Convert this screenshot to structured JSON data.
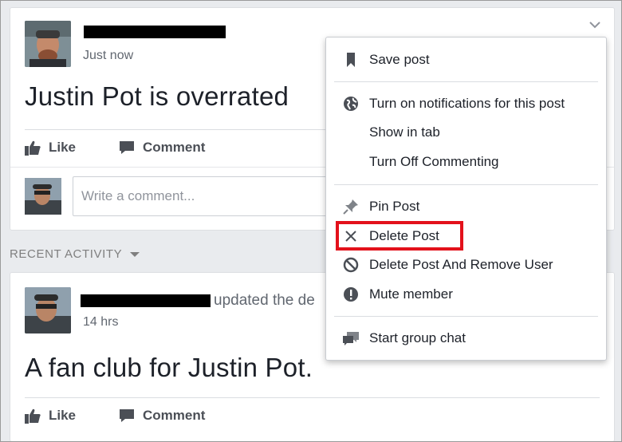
{
  "post1": {
    "timestamp": "Just now",
    "text": "Justin Pot is overrated",
    "like_label": "Like",
    "comment_label": "Comment",
    "comment_placeholder": "Write a comment..."
  },
  "recent_activity": {
    "label": "RECENT ACTIVITY"
  },
  "post2": {
    "action_text": "updated the de",
    "timestamp": "14 hrs",
    "text": "A fan club for Justin Pot.",
    "like_label": "Like",
    "comment_label": "Comment"
  },
  "menu": {
    "items": [
      {
        "label": "Save post",
        "icon": "bookmark-icon"
      },
      {
        "label": "Turn on notifications for this post",
        "icon": "globe-icon"
      },
      {
        "label": "Show in tab",
        "icon": ""
      },
      {
        "label": "Turn Off Commenting",
        "icon": ""
      },
      {
        "label": "Pin Post",
        "icon": "pin-icon"
      },
      {
        "label": "Delete Post",
        "icon": "close-icon"
      },
      {
        "label": "Delete Post And Remove User",
        "icon": "block-icon"
      },
      {
        "label": "Mute member",
        "icon": "alert-icon"
      },
      {
        "label": "Start group chat",
        "icon": "chat-icon"
      }
    ]
  },
  "colors": {
    "highlight": "#e3111b",
    "text": "#1d2129",
    "secondary": "#616770"
  }
}
